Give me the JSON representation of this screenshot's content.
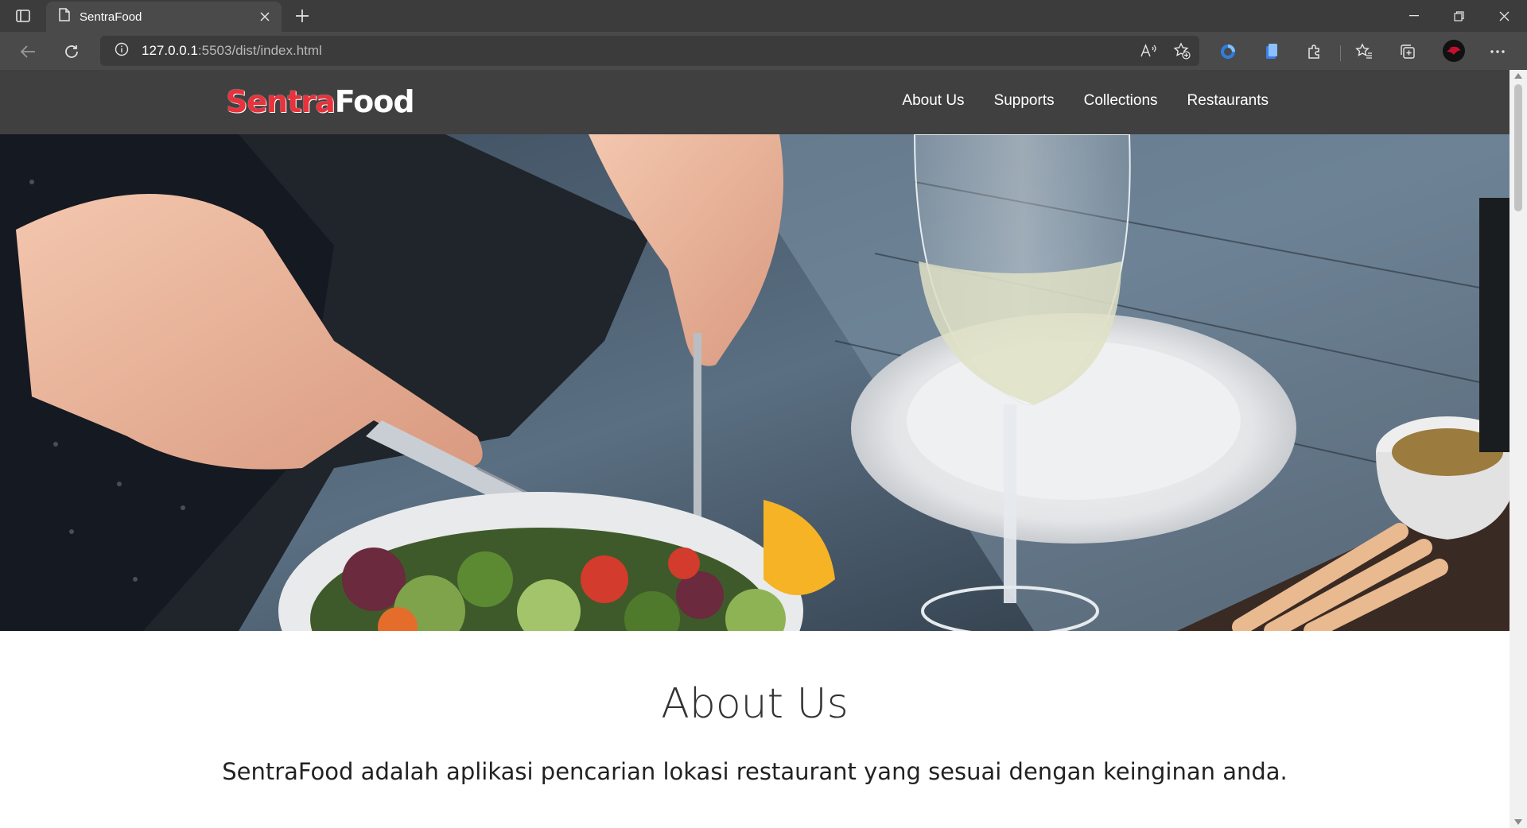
{
  "browser": {
    "tab_title": "SentraFood",
    "url_host": "127.0.0.1",
    "url_path": ":5503/dist/index.html"
  },
  "site": {
    "logo_part1": "Sentra",
    "logo_part2": "Food",
    "logo_colors": {
      "part1": "#e8323c",
      "part2": "#ffffff"
    },
    "header_bg": "#404040",
    "nav": [
      {
        "label": "About Us"
      },
      {
        "label": "Supports"
      },
      {
        "label": "Collections"
      },
      {
        "label": "Restaurants"
      }
    ]
  },
  "about": {
    "title": "About Us",
    "text": "SentraFood adalah aplikasi pencarian lokasi restaurant yang sesuai dengan keinginan anda."
  }
}
